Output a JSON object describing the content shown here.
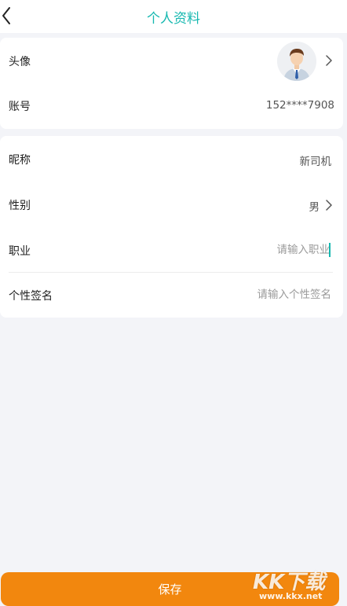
{
  "header": {
    "title": "个人资料",
    "title_color": "#16b8b0"
  },
  "account_card": {
    "avatar_label": "头像",
    "account_label": "账号",
    "account_value": "152****7908"
  },
  "profile_card": {
    "nickname_label": "昵称",
    "nickname_value": "新司机",
    "gender_label": "性别",
    "gender_value": "男",
    "occupation_label": "职业",
    "occupation_placeholder": "请输入职业",
    "signature_label": "个性签名",
    "signature_placeholder": "请输入个性签名"
  },
  "footer": {
    "save_label": "保存",
    "save_color": "#f2870e"
  },
  "watermark": {
    "logo_text": "KK下载",
    "url": "www.kkx.net"
  },
  "icons": {
    "back": "chevron-left-icon",
    "row_arrow": "chevron-right-icon",
    "avatar": "avatar-man-icon"
  }
}
